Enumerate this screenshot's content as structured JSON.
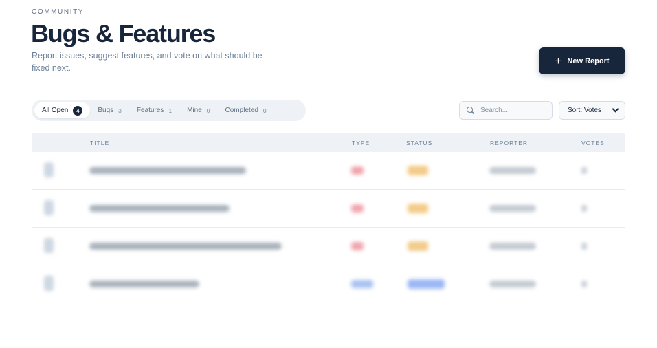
{
  "header": {
    "eyebrow": "COMMUNITY",
    "title": "Bugs & Features",
    "subtitle": "Report issues, suggest features, and vote on what should be fixed next."
  },
  "actions": {
    "new_report_label": "New Report",
    "new_report_icon": "plus-icon"
  },
  "tabs": [
    {
      "label": "All Open",
      "count": "4",
      "active": true
    },
    {
      "label": "Bugs",
      "count": "3",
      "active": false
    },
    {
      "label": "Features",
      "count": "1",
      "active": false
    },
    {
      "label": "Mine",
      "count": "0",
      "active": false
    },
    {
      "label": "Completed",
      "count": "0",
      "active": false
    }
  ],
  "search": {
    "placeholder": "Search...",
    "icon": "search-icon"
  },
  "sort": {
    "label": "Sort: Votes",
    "icon": "chevron-down-icon"
  },
  "table": {
    "columns": [
      "TITLE",
      "TYPE",
      "STATUS",
      "REPORTER",
      "VOTES"
    ]
  },
  "colors": {
    "primary": "#17263a",
    "muted": "#6d8298",
    "bug_chip": "#f1a5ad",
    "feature_chip": "#a9c2f2",
    "status_open_chip": "#f2cc8a",
    "status_progress_chip": "#9bb8f5"
  }
}
